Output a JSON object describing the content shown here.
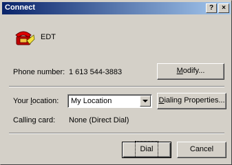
{
  "window": {
    "title": "Connect",
    "help_label": "?",
    "close_label": "×"
  },
  "connection": {
    "name": "EDT",
    "icon": "telephone-icon"
  },
  "phone": {
    "label": "Phone number:",
    "value": "1 613 544-3883",
    "modify_button": "Modify...",
    "modify_mnemonic": "M",
    "modify_rest": "odify..."
  },
  "location": {
    "label_prefix": "Your ",
    "label_mnemonic": "l",
    "label_rest": "ocation:",
    "selected": "My Location",
    "dialing_button": "Dialing Properties...",
    "dialing_mnemonic": "D",
    "dialing_rest": "ialing Properties..."
  },
  "calling_card": {
    "label": "Calling card:",
    "value": "None (Direct Dial)"
  },
  "actions": {
    "dial_label": "Dial",
    "cancel_label": "Cancel"
  }
}
